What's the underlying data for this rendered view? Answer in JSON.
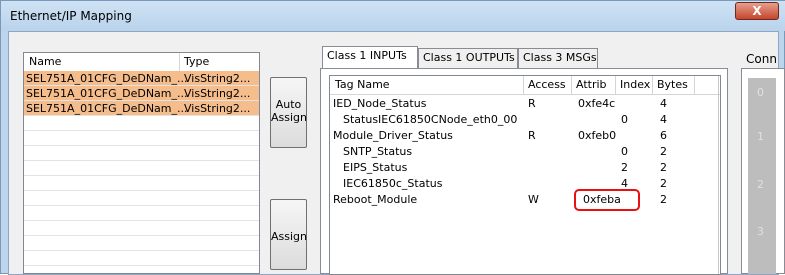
{
  "window": {
    "title": "Ethernet/IP Mapping",
    "close_glyph": "X"
  },
  "left_list": {
    "columns": [
      "Name",
      "Type"
    ],
    "rows": [
      {
        "name": "SEL751A_01CFG_DeDNam_...",
        "type": "VisString2..."
      },
      {
        "name": "SEL751A_01CFG_DeDNam_...",
        "type": "VisString2..."
      },
      {
        "name": "SEL751A_01CFG_DeDNam_...",
        "type": "VisString2..."
      }
    ]
  },
  "buttons": {
    "auto_assign": [
      "Auto",
      "Assign"
    ],
    "assign": "Assign"
  },
  "tabs": [
    "Class 1 INPUTs",
    "Class 1 OUTPUTs",
    "Class 3 MSGs"
  ],
  "grid": {
    "columns": [
      "Tag Name",
      "Access",
      "Attrib",
      "Index",
      "Bytes"
    ],
    "rows": [
      {
        "tag": "IED_Node_Status",
        "access": "R",
        "attrib": "0xfe4c",
        "index": "",
        "bytes": "4"
      },
      {
        "tag": "StatusIEC61850CNode_eth0_00",
        "access": "",
        "attrib": "",
        "index": "0",
        "bytes": "4"
      },
      {
        "tag": "Module_Driver_Status",
        "access": "R",
        "attrib": "0xfeb0",
        "index": "",
        "bytes": "6"
      },
      {
        "tag": "SNTP_Status",
        "access": "",
        "attrib": "",
        "index": "0",
        "bytes": "2"
      },
      {
        "tag": "EIPS_Status",
        "access": "",
        "attrib": "",
        "index": "2",
        "bytes": "2"
      },
      {
        "tag": "IEC61850c_Status",
        "access": "",
        "attrib": "",
        "index": "4",
        "bytes": "2"
      },
      {
        "tag": "Reboot_Module",
        "access": "W",
        "attrib": "0xfeba",
        "index": "",
        "bytes": "2"
      }
    ]
  },
  "conn": {
    "label": "Conn",
    "numbers": [
      "0",
      "1",
      "2",
      "3"
    ]
  },
  "colors": {
    "selected_row": "#f6bd8c",
    "highlight": "#e81010"
  }
}
